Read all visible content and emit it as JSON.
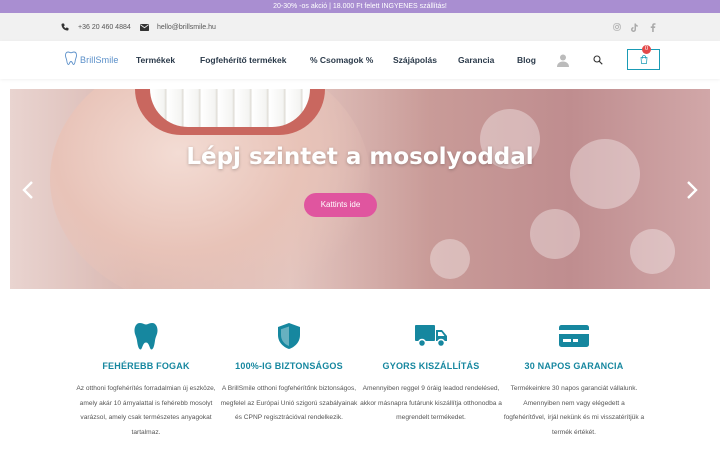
{
  "promo": {
    "text": "20-30% -os akció | 18.000 Ft felett INGYENES szállítás!"
  },
  "contact": {
    "phone": "+36 20 460 4884",
    "email": "hello@brillsmile.hu",
    "social": [
      "instagram-icon",
      "tiktok-icon",
      "facebook-icon"
    ]
  },
  "nav": {
    "logo": "BrillSmile",
    "links": [
      "Termékek",
      "Fogfehérítő termékek",
      "% Csomagok %",
      "Szájápolás",
      "Garancia",
      "Blog"
    ],
    "cart_count": "0",
    "accent": "#1a9bb5"
  },
  "hero": {
    "title": "Lépj szintet a mosolyoddal",
    "button": "Kattints ide",
    "button_color": "#e0559f"
  },
  "features": [
    {
      "icon": "tooth-icon",
      "title": "FEHÉREBB FOGAK",
      "text": "Az otthoni fogfehérítés forradalmian új eszköze, amely akár 10 árnyalattal is fehérebb mosolyt varázsol, amely csak természetes anyagokat tartalmaz."
    },
    {
      "icon": "shield-icon",
      "title": "100%-IG BIZTONSÁGOS",
      "text": "A BrillSmile otthoni fogfehérítőnk biztonságos, megfelel az Európai Unió szigorú szabályainak és CPNP regisztrációval rendelkezik."
    },
    {
      "icon": "truck-icon",
      "title": "GYORS KISZÁLLÍTÁS",
      "text": "Amennyiben reggel 9 óráig leadod rendelésed, akkor másnapra futárunk kiszállítja otthonodba a megrendelt termékedet."
    },
    {
      "icon": "credit-card-icon",
      "title": "30 NAPOS GARANCIA",
      "text": "Termékeinkre 30 napos garanciát vállalunk. Amennyiben nem vagy elégedett a fogfehérítővel, írjál nekünk és mi visszatérítjük a termék értékét."
    }
  ]
}
